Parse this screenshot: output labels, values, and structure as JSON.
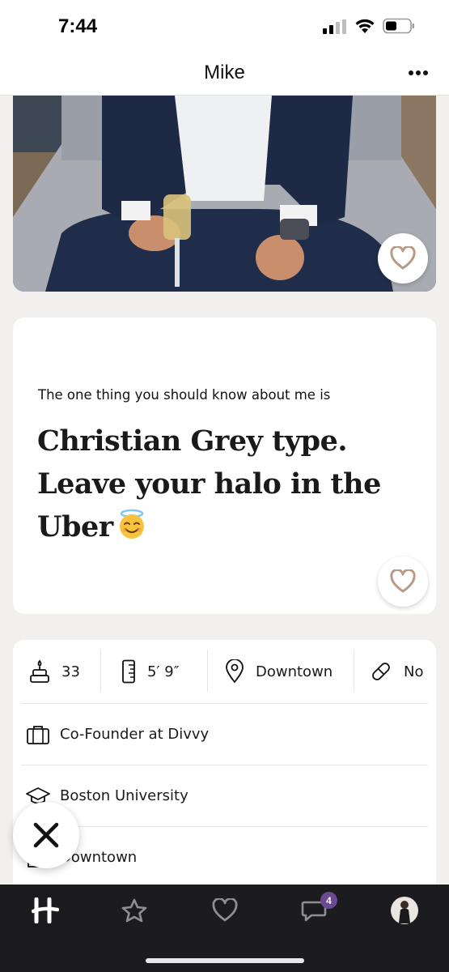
{
  "status_bar": {
    "time": "7:44"
  },
  "header": {
    "title": "Mike"
  },
  "prompt": {
    "question": "The one thing you should know about me is",
    "answer_lines": [
      "Christian Grey type.",
      "Leave your halo in the",
      "Uber"
    ]
  },
  "vitals": [
    {
      "icon": "cake-icon",
      "label": "33"
    },
    {
      "icon": "ruler-icon",
      "label": "5′ 9″"
    },
    {
      "icon": "location-pin-icon",
      "label": "Downtown"
    },
    {
      "icon": "pill-icon",
      "label": "No"
    }
  ],
  "info_rows": [
    {
      "icon": "briefcase-icon",
      "label": "Co-Founder at Divvy"
    },
    {
      "icon": "graduation-cap-icon",
      "label": "Boston University"
    },
    {
      "icon": "home-icon",
      "label": "Downtown"
    }
  ],
  "tab_bar": {
    "tabs": [
      "hinge-logo-icon",
      "star-icon",
      "heart-icon",
      "chat-icon",
      "profile-avatar"
    ],
    "messages_badge": "4"
  },
  "colors": {
    "like_heart": "#b79b86",
    "badge": "#6b4a92",
    "tab_bar_bg": "#1c1c1e",
    "page_bg": "#f1f0ef"
  }
}
